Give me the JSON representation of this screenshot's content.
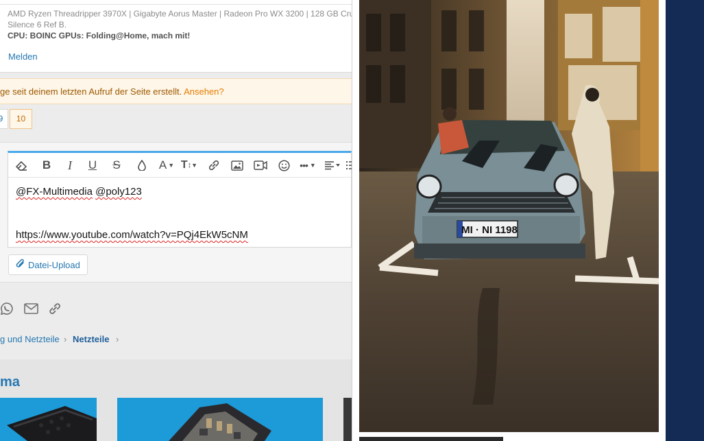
{
  "signature": {
    "line1": "AMD Ryzen Threadripper 3970X | Gigabyte Aorus Master | Radeon Pro WX 3200 | 128 GB Cru",
    "line2": "Silence 6 Ref B.",
    "line3": "CPU: BOINC GPUs: Folding@Home, mach mit!"
  },
  "post_actions": {
    "report": "Melden"
  },
  "notice": {
    "text": "ge seit deinem letzten Aufruf der Seite erstellt. ",
    "link": "Ansehen?"
  },
  "pagination": {
    "pages": [
      "9",
      "10"
    ],
    "current": "10"
  },
  "editor": {
    "toolbar": [
      "eraser-icon",
      "bold-icon",
      "italic-icon",
      "underline-icon",
      "strikethrough-icon",
      "text-color-icon",
      "font-family-icon",
      "font-size-icon",
      "link-icon",
      "image-icon",
      "video-icon",
      "smiley-icon",
      "more-icon",
      "align-icon",
      "list-icon"
    ],
    "content": {
      "mention1": "@FX-Multimedia",
      "mention2": "@poly123",
      "url": "https://www.youtube.com/watch?v=PQj4EkW5cNM"
    },
    "upload_label": "Datei-Upload"
  },
  "share_icons": [
    "whatsapp-icon",
    "email-icon",
    "link-icon"
  ],
  "breadcrumb": {
    "item1": "g und Netzteile",
    "item2": "Netzteile"
  },
  "similar": {
    "title": "ma"
  },
  "ad": {
    "license_plate": "MI · NI 1198"
  },
  "colors": {
    "accent": "#2577b1",
    "notice_bg": "#fef6e9",
    "editor_top": "#47a7eb",
    "side_bar": "#142c55"
  }
}
